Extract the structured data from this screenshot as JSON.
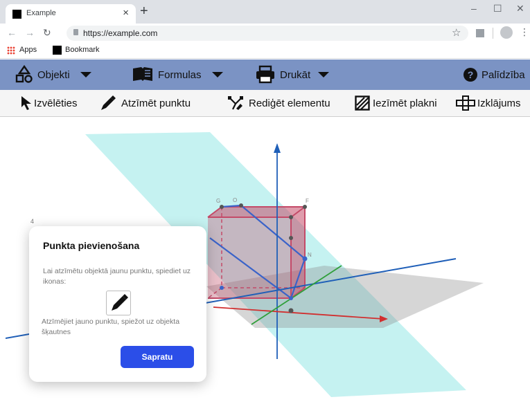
{
  "browser": {
    "tab_title": "Example",
    "tab_close": "×",
    "new_tab": "+",
    "url": "https://example.com",
    "window_controls": [
      "–",
      "☐",
      "✕"
    ],
    "bookmarks": [
      "Apps",
      "Bookmark"
    ]
  },
  "menubar": {
    "items": [
      {
        "label": "Objekti",
        "icon": "shapes-icon"
      },
      {
        "label": "Formulas",
        "icon": "book-icon"
      },
      {
        "label": "Drukāt",
        "icon": "printer-icon"
      }
    ],
    "help_label": "Palīdzība"
  },
  "toolbar": {
    "tools": [
      {
        "label": "Izvēlēties",
        "icon": "cursor-icon"
      },
      {
        "label": "Atzīmēt punktu",
        "icon": "pen-icon"
      },
      {
        "label": "Rediģēt elementu",
        "icon": "edit-vertex-icon"
      },
      {
        "label": "Iezīmēt plakni",
        "icon": "plane-icon"
      },
      {
        "label": "Izklājums",
        "icon": "net-icon"
      }
    ]
  },
  "canvas": {
    "axis_tick": "4",
    "vertex_labels": [
      "G",
      "O",
      "F",
      "N"
    ]
  },
  "dialog": {
    "title": "Punkta pievienošana",
    "text1": "Lai atzīmētu objektā jaunu punktu, spiediet uz ikonas:",
    "text2": "Atzīmējiet jauno punktu, spiežot uz objekta šķautnes",
    "button": "Sapratu"
  },
  "colors": {
    "menubar": "#7b93c4",
    "accent_button": "#2b4ee8",
    "plane": "#7fe3e0",
    "cube": "#c44a68",
    "axis_blue": "#1f5fb8",
    "axis_red": "#d12f2f",
    "axis_green": "#2f9f3a"
  }
}
